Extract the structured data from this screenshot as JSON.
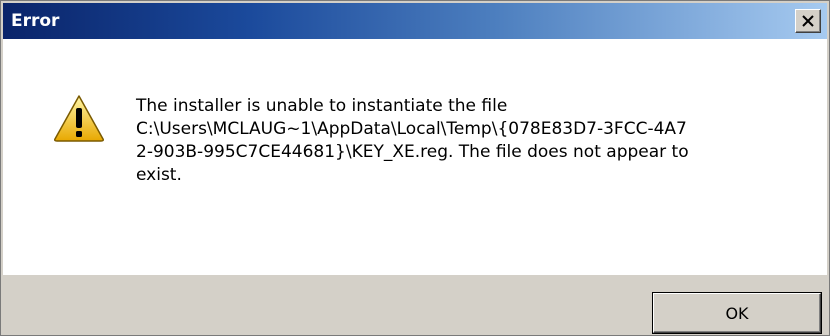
{
  "window": {
    "title": "Error",
    "close_label": "×"
  },
  "dialog": {
    "icon": "warning-icon",
    "message_lines": [
      "The installer is unable to instantiate the file",
      "C:\\Users\\MCLAUG~1\\AppData\\Local\\Temp\\{078E83D7-3FCC-4A7",
      "2-903B-995C7CE44681}\\KEY_XE.reg.  The file does not appear to",
      "exist."
    ]
  },
  "buttons": {
    "ok_label": "OK"
  },
  "colors": {
    "titlebar_start": "#0a246a",
    "titlebar_end": "#a6caf0",
    "face": "#d4d0c8",
    "content_bg": "#ffffff",
    "warning_yellow": "#f5c518"
  }
}
